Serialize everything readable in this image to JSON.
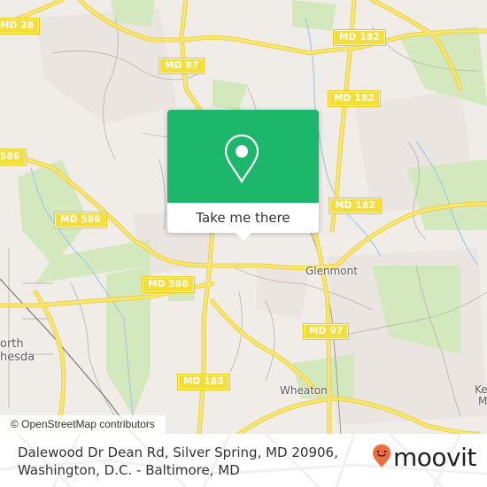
{
  "map": {
    "road_labels": [
      {
        "id": "md28",
        "text": "MD 28"
      },
      {
        "id": "md97-north",
        "text": "MD 97"
      },
      {
        "id": "md182-a",
        "text": "MD 182"
      },
      {
        "id": "md182-b",
        "text": "MD 182"
      },
      {
        "id": "md182-c",
        "text": "MD 182"
      },
      {
        "id": "md586-a",
        "text": "586"
      },
      {
        "id": "md586-b",
        "text": "MD 586"
      },
      {
        "id": "md586-c",
        "text": "MD 586"
      },
      {
        "id": "md97-south",
        "text": "MD 97"
      },
      {
        "id": "md185",
        "text": "MD 185"
      }
    ],
    "places": [
      {
        "id": "glenmont",
        "text": "Glenmont"
      },
      {
        "id": "wheaton",
        "text": "Wheaton"
      },
      {
        "id": "north-bethesda-1",
        "text": "orth"
      },
      {
        "id": "north-bethesda-2",
        "text": "hesda"
      },
      {
        "id": "kensington-1",
        "text": "Ke"
      },
      {
        "id": "kensington-2",
        "text": "M"
      }
    ],
    "attribution": "© OpenStreetMap contributors",
    "colors": {
      "land": "#f0ede9",
      "park": "#cfe8b4",
      "road_major": "#f5dd4e",
      "water": "#9ecbe8"
    }
  },
  "popup": {
    "icon": "location-pin-icon",
    "cta_label": "Take me there",
    "accent_color": "#1db76b"
  },
  "footer": {
    "address_line1": "Dalewood Dr Dean Rd, Silver Spring, MD 20906,",
    "address_line2": "Washington, D.C. - Baltimore, MD",
    "logo_text": "moovit",
    "logo_color": "#f26b38"
  }
}
